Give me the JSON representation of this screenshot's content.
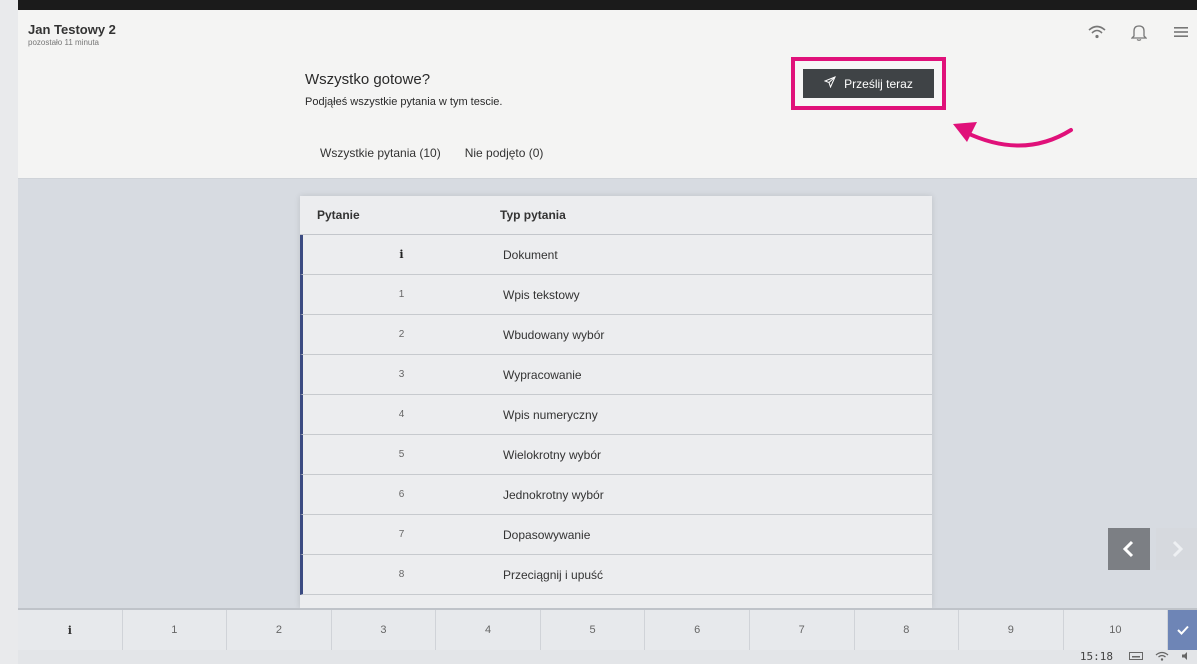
{
  "user": {
    "name": "Jan Testowy 2",
    "time_left": "pozostało 11 minuta"
  },
  "header": {
    "title": "Wszystko gotowe?",
    "subtitle": "Podjąłeś wszystkie pytania w tym tescie.",
    "send_button": "Prześlij teraz"
  },
  "tabs": [
    {
      "label": "Wszystkie pytania (10)"
    },
    {
      "label": "Nie podjęto (0)"
    }
  ],
  "table": {
    "headers": {
      "question": "Pytanie",
      "type": "Typ pytania"
    },
    "rows": [
      {
        "num": "i",
        "type": "Dokument"
      },
      {
        "num": "1",
        "type": "Wpis tekstowy"
      },
      {
        "num": "2",
        "type": "Wbudowany wybór"
      },
      {
        "num": "3",
        "type": "Wypracowanie"
      },
      {
        "num": "4",
        "type": "Wpis numeryczny"
      },
      {
        "num": "5",
        "type": "Wielokrotny wybór"
      },
      {
        "num": "6",
        "type": "Jednokrotny wybór"
      },
      {
        "num": "7",
        "type": "Dopasowywanie"
      },
      {
        "num": "8",
        "type": "Przeciągnij i upuść"
      }
    ]
  },
  "bottom_nav": [
    "i",
    "1",
    "2",
    "3",
    "4",
    "5",
    "6",
    "7",
    "8",
    "9",
    "10"
  ],
  "status": {
    "clock": "15:18"
  },
  "colors": {
    "highlight": "#e0117a",
    "send_bg": "#3f4346",
    "accent_blue": "#3b4b82",
    "check_bg": "#6e85b6"
  },
  "icons": [
    "wifi-icon",
    "bell-icon",
    "menu-icon",
    "send-icon",
    "chevron-left-icon",
    "chevron-right-icon",
    "check-icon",
    "keyboard-icon",
    "volume-icon"
  ]
}
